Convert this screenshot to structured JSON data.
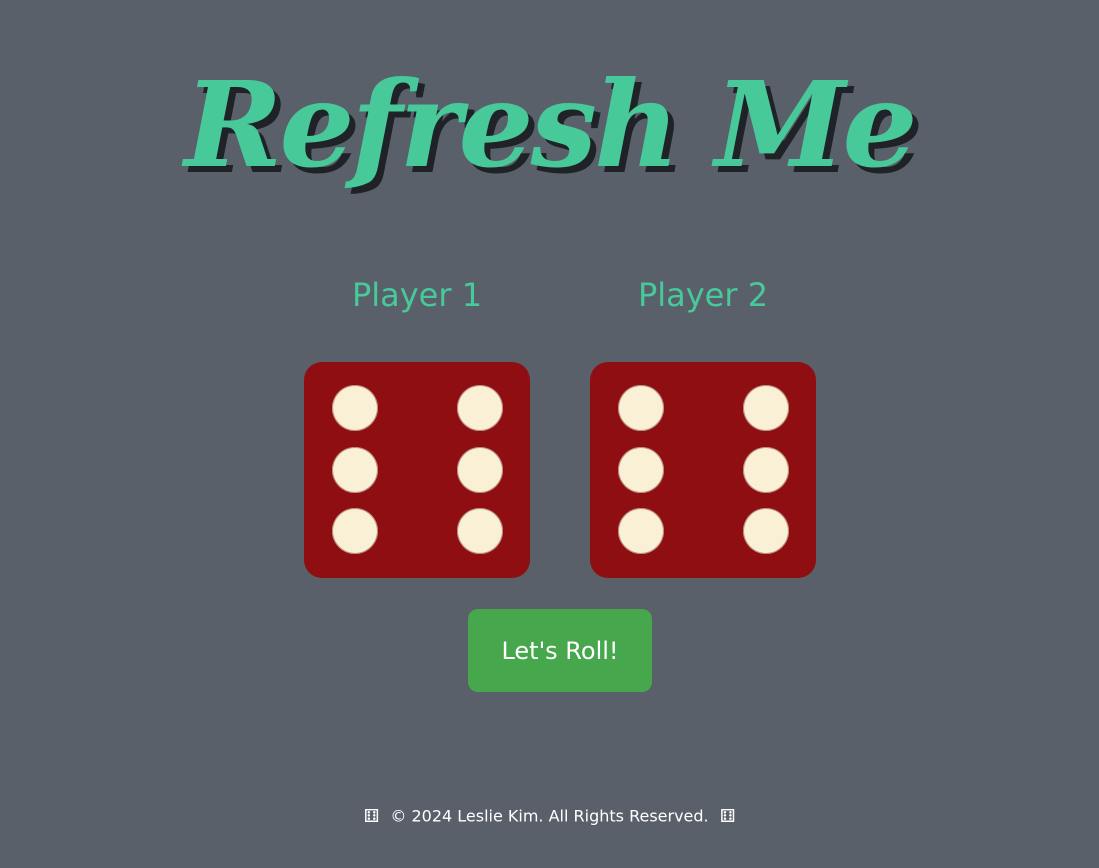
{
  "header": {
    "title": "Refresh Me"
  },
  "players": [
    {
      "label": "Player 1",
      "die_value": 6
    },
    {
      "label": "Player 2",
      "die_value": 6
    }
  ],
  "controls": {
    "roll_label": "Let's Roll!"
  },
  "footer": {
    "icon_left": "dice-icon",
    "text": "© 2024 Leslie Kim. All Rights Reserved.",
    "icon_right": "dice-icon"
  },
  "colors": {
    "background": "#5a606a",
    "title": "#47c99a",
    "die_face": "#8f0e11",
    "pip": "#f9f0d6",
    "button": "#46a74c"
  }
}
